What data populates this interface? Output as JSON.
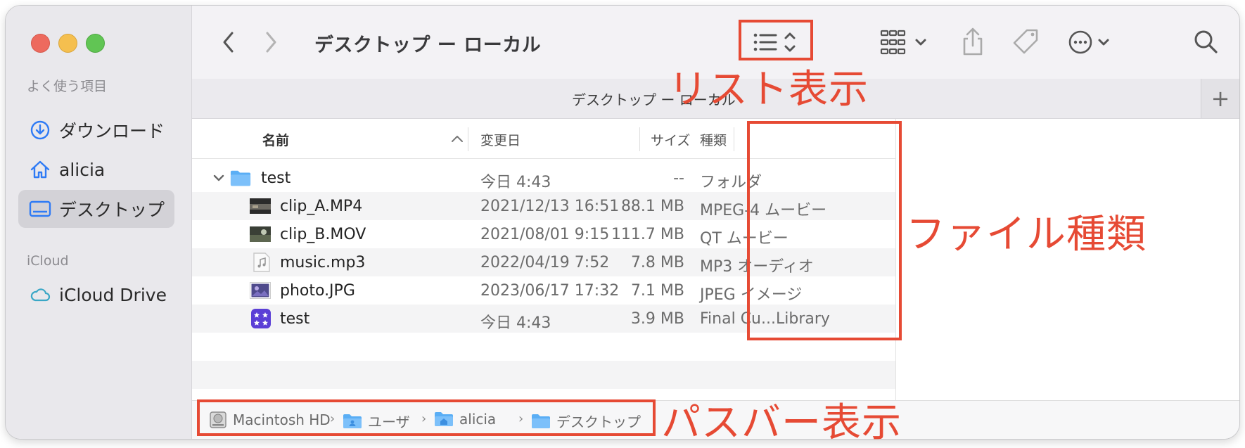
{
  "window": {
    "title": "デスクトップ ー ローカル"
  },
  "sidebar": {
    "favorites_header": "よく使う項目",
    "favorites": [
      {
        "label": "ダウンロード",
        "icon": "download-circle-icon"
      },
      {
        "label": "alicia",
        "icon": "home-icon"
      },
      {
        "label": "デスクトップ",
        "icon": "desktop-icon",
        "selected": true
      }
    ],
    "icloud_header": "iCloud",
    "icloud": [
      {
        "label": "iCloud Drive",
        "icon": "cloud-icon"
      }
    ]
  },
  "tab": {
    "label": "デスクトップ ー ローカル",
    "plus": "+"
  },
  "columns": {
    "name": "名前",
    "date": "変更日",
    "size": "サイズ",
    "kind": "種類"
  },
  "rows": [
    {
      "name": "test",
      "date": "今日 4:43",
      "size": "--",
      "kind": "フォルダ",
      "icon": "folder-icon",
      "expanded": true
    },
    {
      "name": "clip_A.MP4",
      "date": "2021/12/13 16:51",
      "size": "88.1 MB",
      "kind": "MPEG-4 ムービー",
      "icon": "video-thumb-icon"
    },
    {
      "name": "clip_B.MOV",
      "date": "2021/08/01 9:15",
      "size": "111.7 MB",
      "kind": "QT ムービー",
      "icon": "video-thumb-icon"
    },
    {
      "name": "music.mp3",
      "date": "2022/04/19 7:52",
      "size": "7.8 MB",
      "kind": "MP3 オーディオ",
      "icon": "music-file-icon"
    },
    {
      "name": "photo.JPG",
      "date": "2023/06/17 17:32",
      "size": "7.1 MB",
      "kind": "JPEG イメージ",
      "icon": "image-thumb-icon"
    },
    {
      "name": "test",
      "date": "今日 4:43",
      "size": "3.9 MB",
      "kind": "Final Cu...Library",
      "icon": "fcp-library-icon"
    }
  ],
  "pathbar": [
    {
      "label": "Macintosh HD",
      "icon": "hard-drive-icon"
    },
    {
      "label": "ユーザ",
      "icon": "folder-icon"
    },
    {
      "label": "alicia",
      "icon": "home-folder-icon"
    },
    {
      "label": "デスクトップ",
      "icon": "folder-icon"
    }
  ],
  "annotations": {
    "list_view": "リスト表示",
    "file_kind": "ファイル種類",
    "path_bar": "パスバー表示"
  },
  "colors": {
    "annotation": "#e64a34",
    "accent": "#2f7bf5",
    "folder": "#5aaef5"
  }
}
